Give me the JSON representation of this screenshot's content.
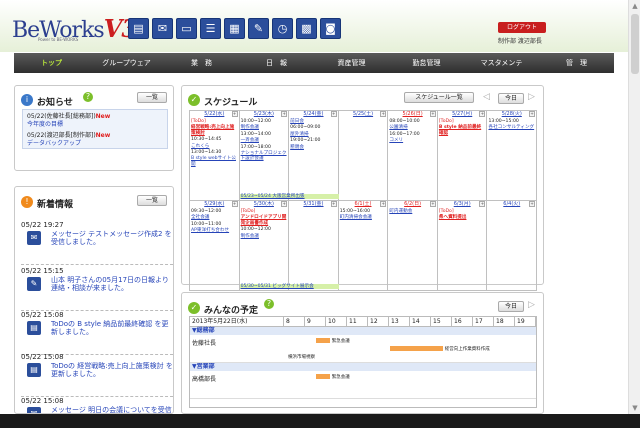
{
  "header": {
    "logo_main": "BeWorks",
    "logo_version": "V3",
    "logo_sub": "Power to BE-WORKS",
    "logout_label": "ログアウト",
    "user_label": "制作部 渡辺部長",
    "toolbar_icons": [
      "layout-icon",
      "mail-icon",
      "folder-icon",
      "notepad-icon",
      "report-icon",
      "edit-icon",
      "clock-icon",
      "calendar-icon",
      "chat-icon"
    ]
  },
  "nav": {
    "items": [
      "トップ",
      "グループウェア",
      "業　務",
      "日　報",
      "資産管理",
      "勤怠管理",
      "マスタメンテ",
      "管　理"
    ]
  },
  "notice": {
    "title": "お知らせ",
    "list_button": "一覧",
    "items": [
      {
        "meta": "05/22(佐藤社長[総務部])",
        "badge": "New",
        "link": "今年度の目標"
      },
      {
        "meta": "05/22(渡辺部長[制作部])",
        "badge": "New",
        "link": "データバックアップ"
      }
    ]
  },
  "info": {
    "title": "新着情報",
    "list_button": "一覧",
    "items": [
      {
        "time": "05/22 19:27",
        "text": "メッセージ テストメッセージ作成2 を受信しました。",
        "icon": "mail-icon"
      },
      {
        "time": "05/22 15:15",
        "text": "山本 明子さんの05月17日の日報より連絡・相談が来ました。",
        "icon": "pen-icon"
      },
      {
        "time": "05/22 15:08",
        "text": "ToDoの B style 納品前最終確認 を更新しました。",
        "icon": "todo-icon"
      },
      {
        "time": "05/22 15:08",
        "text": "ToDoの 経営戦略:売上向上施策検討 を更新しました。",
        "icon": "todo-icon"
      },
      {
        "time": "05/22 15:08",
        "text": "メッセージ 明日の会議についてを受信しました。",
        "icon": "mail-icon"
      }
    ]
  },
  "schedule": {
    "title": "スケジュール",
    "list_button": "スケジュール一覧",
    "today_button": "今日",
    "weeks": [
      [
        {
          "date": "5/22(水)",
          "events": [
            {
              "text": "[ToDo]",
              "style": "todo"
            },
            {
              "text": "経営戦略:売上向上施策検討",
              "style": "red"
            },
            {
              "text": "10:30~14:45",
              "style": "time"
            },
            {
              "text": "これくら",
              "style": "blue"
            },
            {
              "text": "13:00~14:30",
              "style": "time"
            },
            {
              "text": "B style webサイト公開",
              "style": "blue"
            }
          ]
        },
        {
          "date": "5/23(木)",
          "events": [
            {
              "text": "10:00~12:00",
              "style": "time"
            },
            {
              "text": "制作会議",
              "style": "blue"
            },
            {
              "text": "13:00~14:00",
              "style": "time"
            },
            {
              "text": "一斉会議",
              "style": "blue"
            },
            {
              "text": "17:00~18:00",
              "style": "time"
            },
            {
              "text": "ナショナルプロジェクト設計会議",
              "style": "blue"
            }
          ]
        },
        {
          "date": "5/24(金)",
          "events": [
            {
              "text": "前日会",
              "style": "blue"
            },
            {
              "text": "06:00~09:00",
              "style": "time"
            },
            {
              "text": "屋外清掃",
              "style": "blue"
            },
            {
              "text": "19:00~21:00",
              "style": "time"
            },
            {
              "text": "懇親会",
              "style": "blue"
            }
          ]
        },
        {
          "date": "5/25(土)",
          "events": []
        },
        {
          "date": "5/26(日)",
          "red": true,
          "events": [
            {
              "text": "08:00~10:00",
              "style": "time"
            },
            {
              "text": "公園清掃",
              "style": "blue"
            },
            {
              "text": "16:00~17:00",
              "style": "time"
            },
            {
              "text": "コメリ",
              "style": "blue"
            }
          ]
        },
        {
          "date": "5/27(月)",
          "events": [
            {
              "text": "[ToDo]",
              "style": "todo"
            },
            {
              "text": "B style 納品前最終確認",
              "style": "red"
            }
          ]
        },
        {
          "date": "5/28(火)",
          "events": [
            {
              "text": "13:00~15:00",
              "style": "time"
            },
            {
              "text": "各社コンサルティング",
              "style": "blue"
            }
          ]
        }
      ],
      [
        {
          "date": "5/29(水)",
          "events": [
            {
              "text": "09:30~12:00",
              "style": "time"
            },
            {
              "text": "全社会議",
              "style": "blue"
            },
            {
              "text": "10:00~11:00",
              "style": "time"
            },
            {
              "text": "AP東洋打ち合わせ",
              "style": "blue"
            }
          ]
        },
        {
          "date": "5/30(木)",
          "events": [
            {
              "text": "[ToDo]",
              "style": "todo"
            },
            {
              "text": "アンドロイドアプリ開発企画書作成",
              "style": "red"
            },
            {
              "text": "10:00~12:00",
              "style": "time"
            },
            {
              "text": "制作会議",
              "style": "blue"
            }
          ]
        },
        {
          "date": "5/31(金)",
          "events": []
        },
        {
          "date": "6/1(土)",
          "red": true,
          "events": [
            {
              "text": "15:00~16:00",
              "style": "time"
            },
            {
              "text": "町内清掃会会議",
              "style": "blue"
            }
          ]
        },
        {
          "date": "6/2(日)",
          "red": true,
          "events": [
            {
              "text": "町内運動会",
              "style": "blue"
            }
          ]
        },
        {
          "date": "6/3(月)",
          "events": [
            {
              "text": "[ToDo]",
              "style": "todo"
            },
            {
              "text": "県へ資料提出",
              "style": "red"
            }
          ]
        },
        {
          "date": "6/4(火)",
          "events": []
        }
      ]
    ],
    "banners": [
      {
        "text": "05/23~05/24 大阪営業所出張",
        "week": 0
      },
      {
        "text": "05/30~05/31 ビッグサイト展示会",
        "week": 1
      }
    ]
  },
  "minna": {
    "title": "みんなの予定",
    "today_button": "今日",
    "date_label": "2013年5月22日(水)",
    "hours": [
      "8",
      "9",
      "10",
      "11",
      "12",
      "13",
      "14",
      "15",
      "16",
      "17",
      "18",
      "19"
    ],
    "departments": [
      {
        "name": "総務部",
        "rows": [
          {
            "person": "佐藤社長",
            "events": [
              {
                "label": "緊急会議",
                "start": 9.5,
                "end": 10
              },
              {
                "label": "経営向上作業資料作成",
                "start": 13,
                "end": 15.5
              },
              {
                "label": "横浜市場視察",
                "start": 8,
                "end": 19
              }
            ]
          }
        ]
      },
      {
        "name": "営業部",
        "rows": [
          {
            "person": "高橋部長",
            "events": [
              {
                "label": "緊急会議",
                "start": 9.5,
                "end": 10
              }
            ]
          }
        ]
      }
    ]
  }
}
